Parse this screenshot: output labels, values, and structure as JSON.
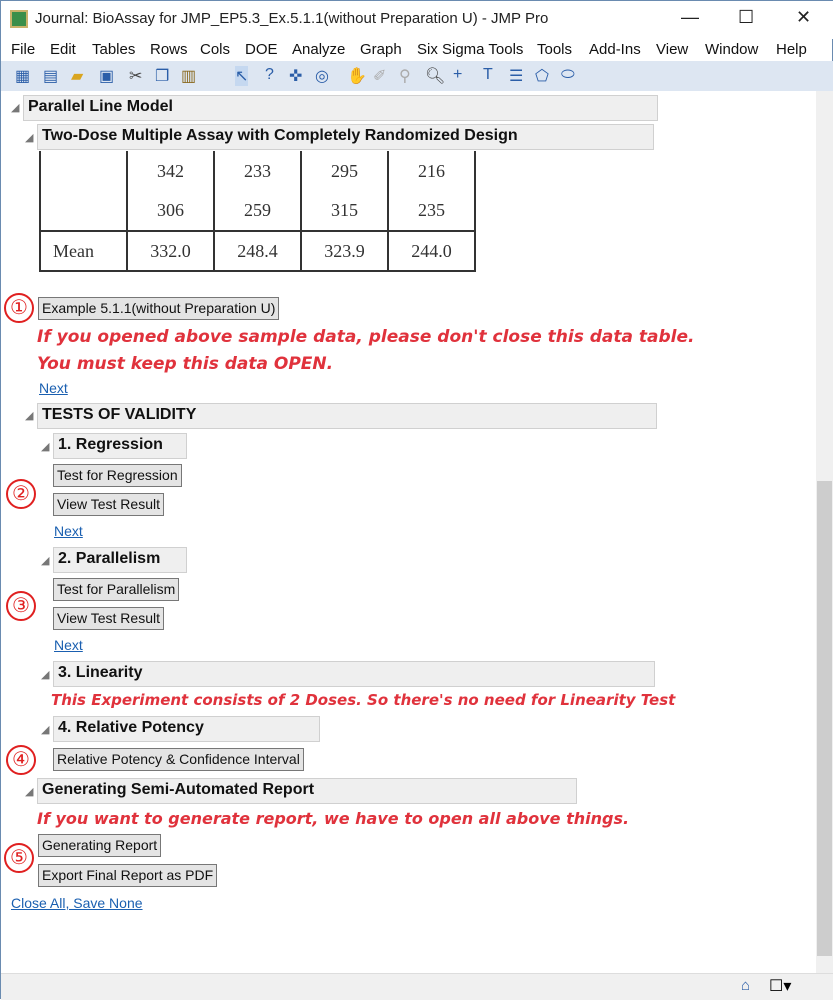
{
  "window": {
    "title": "Journal: BioAssay for JMP_EP5.3_Ex.5.1.1(without Preparation U) - JMP Pro",
    "minimize": "—",
    "maximize": "☐",
    "close": "✕"
  },
  "menu": [
    "File",
    "Edit",
    "Tables",
    "Rows",
    "Cols",
    "DOE",
    "Analyze",
    "Graph",
    "Six Sigma Tools",
    "Tools",
    "Add-Ins",
    "View",
    "Window",
    "Help"
  ],
  "toolbar_icons": [
    "new-journal",
    "new-data",
    "open",
    "save",
    "cut",
    "copy",
    "paste",
    "arrow",
    "help",
    "crosshair",
    "target",
    "hand",
    "brush",
    "lasso",
    "magnifier",
    "plus",
    "text",
    "lines",
    "polygon",
    "oval"
  ],
  "report": {
    "parallel_line_model": "Parallel Line Model",
    "two_dose": "Two-Dose Multiple Assay with Completely Randomized Design",
    "table": {
      "rows": [
        [
          "",
          "342",
          "233",
          "295",
          "216"
        ],
        [
          "",
          "306",
          "259",
          "315",
          "235"
        ],
        [
          "Mean",
          "332.0",
          "248.4",
          "323.9",
          "244.0"
        ]
      ]
    },
    "step1": "①",
    "example_button": "Example 5.1.1(without Preparation U)",
    "warning1": "If you opened above sample data, please don't close this data table.",
    "warning2": "You must keep this data OPEN.",
    "next": "Next",
    "tests_of_validity": "TESTS OF VALIDITY",
    "regression": "1. Regression",
    "step2": "②",
    "test_regression": "Test for Regression",
    "view_result": "View Test Result",
    "parallelism": "2. Parallelism",
    "step3": "③",
    "test_parallelism": "Test for Parallelism",
    "linearity": "3. Linearity",
    "linearity_note": "This Experiment consists of 2 Doses. So there's no need for Linearity Test",
    "relative_potency": "4. Relative Potency",
    "step4": "④",
    "rp_button": "Relative Potency & Confidence Interval",
    "generating": "Generating Semi-Automated Report",
    "gen_note": "If you want to generate report, we have to open all above things.",
    "step5": "⑤",
    "gen_report": "Generating Report",
    "export_pdf": "Export Final Report as PDF",
    "close_all": "Close All, Save None"
  }
}
